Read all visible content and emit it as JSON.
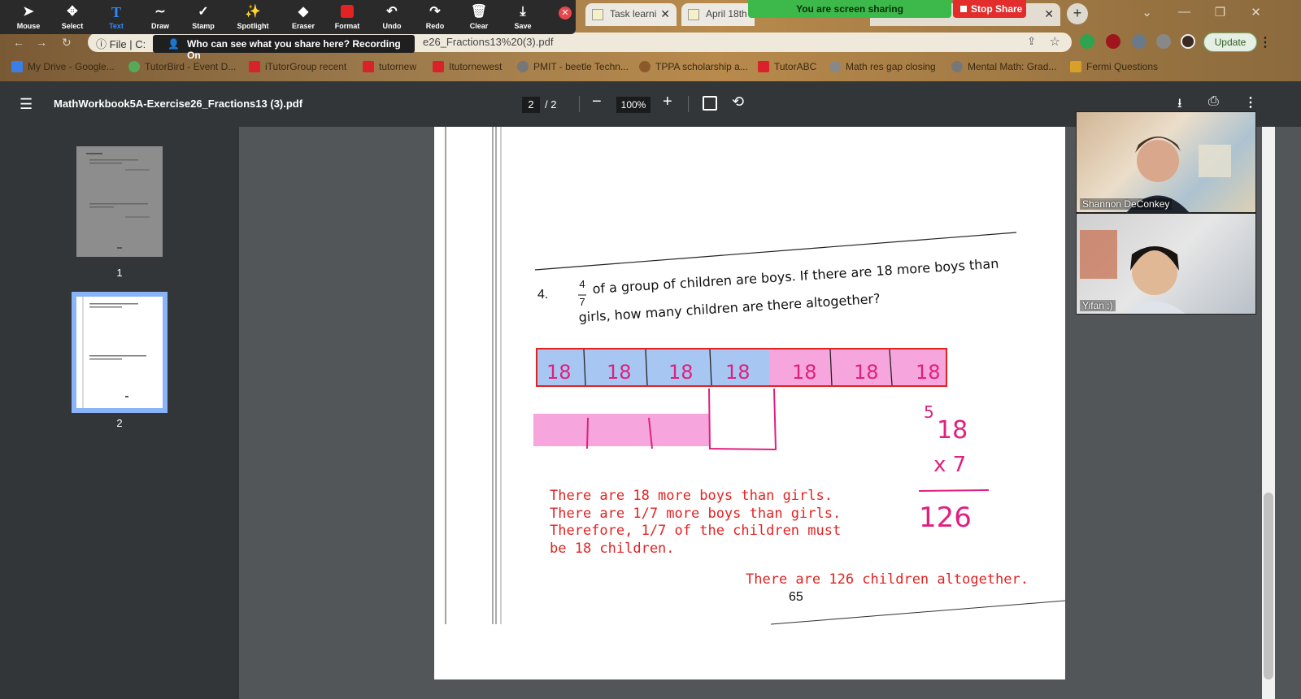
{
  "annotation_toolbar": {
    "tools": [
      {
        "label": "Mouse",
        "icon": "mouse-pointer-icon"
      },
      {
        "label": "Select",
        "icon": "move-icon"
      },
      {
        "label": "Text",
        "icon": "text-icon"
      },
      {
        "label": "Draw",
        "icon": "draw-icon"
      },
      {
        "label": "Stamp",
        "icon": "stamp-icon"
      },
      {
        "label": "Spotlight",
        "icon": "spotlight-icon"
      },
      {
        "label": "Eraser",
        "icon": "eraser-icon"
      },
      {
        "label": "Format",
        "icon": "format-icon"
      },
      {
        "label": "Undo",
        "icon": "undo-icon"
      },
      {
        "label": "Redo",
        "icon": "redo-icon"
      },
      {
        "label": "Clear",
        "icon": "trash-icon"
      },
      {
        "label": "Save",
        "icon": "save-icon"
      }
    ],
    "active_tool": "Text",
    "recording_tip": "Who can see what you share here? Recording On"
  },
  "screen_share": {
    "banner": "You are screen sharing",
    "stop_label": "Stop Share"
  },
  "browser": {
    "tabs": [
      {
        "title": "Task learni"
      },
      {
        "title": "April 18th"
      }
    ],
    "omnibox_info": "File",
    "omnibox_partial": "C:",
    "url": "e26_Fractions13%20(3).pdf",
    "update_label": "Update",
    "bookmarks": [
      {
        "label": "My Drive - Google...",
        "color": "#3a7ee8"
      },
      {
        "label": "TutorBird - Event D...",
        "color": "#58a85a"
      },
      {
        "label": "iTutorGroup recent",
        "color": "#d8232a"
      },
      {
        "label": "tutornew",
        "color": "#d8232a"
      },
      {
        "label": "Itutornewest",
        "color": "#d8232a"
      },
      {
        "label": "PMIT - beetle Techn...",
        "color": "#777777"
      },
      {
        "label": "TPPA scholarship a...",
        "color": "#8a5a2a"
      },
      {
        "label": "TutorABC",
        "color": "#d8232a"
      },
      {
        "label": "Math res gap closing",
        "color": "#888888"
      },
      {
        "label": "Mental Math: Grad...",
        "color": "#777777"
      },
      {
        "label": "Fermi Questions",
        "color": "#d8a02a"
      }
    ]
  },
  "pdf_viewer": {
    "title": "MathWorkbook5A-Exercise26_Fractions13 (3).pdf",
    "current_page": "2",
    "page_total": "/ 2",
    "zoom": "100%",
    "thumbnails": [
      {
        "number": "1"
      },
      {
        "number": "2"
      }
    ]
  },
  "document": {
    "problem_number": "4.",
    "fraction_num": "4",
    "fraction_den": "7",
    "line1": "of a group of children are boys. If there are 18 more boys than",
    "line2": "girls, how many children are there altogether?",
    "bar_units": [
      "18",
      "18",
      "18",
      "18",
      "18",
      "18",
      "18"
    ],
    "explanation": "There are 18 more boys than girls.\nThere are 1/7 more boys than girls.\nTherefore, 1/7 of the children must\nbe 18 children.",
    "answer": "There are 126 children altogether.",
    "calc_carry": "5",
    "calc_top": "18",
    "calc_mult": "x 7",
    "calc_result": "126",
    "page_number": "65"
  },
  "participants": [
    {
      "name": "Shannon DeConkey"
    },
    {
      "name": "Yifan :)"
    }
  ],
  "colors": {
    "boys_fill": "#a7c7f2",
    "girls_fill": "#f6a6dc",
    "bar_border": "#e32222",
    "handwriting": "#e0207f",
    "note_text": "#e32222"
  }
}
